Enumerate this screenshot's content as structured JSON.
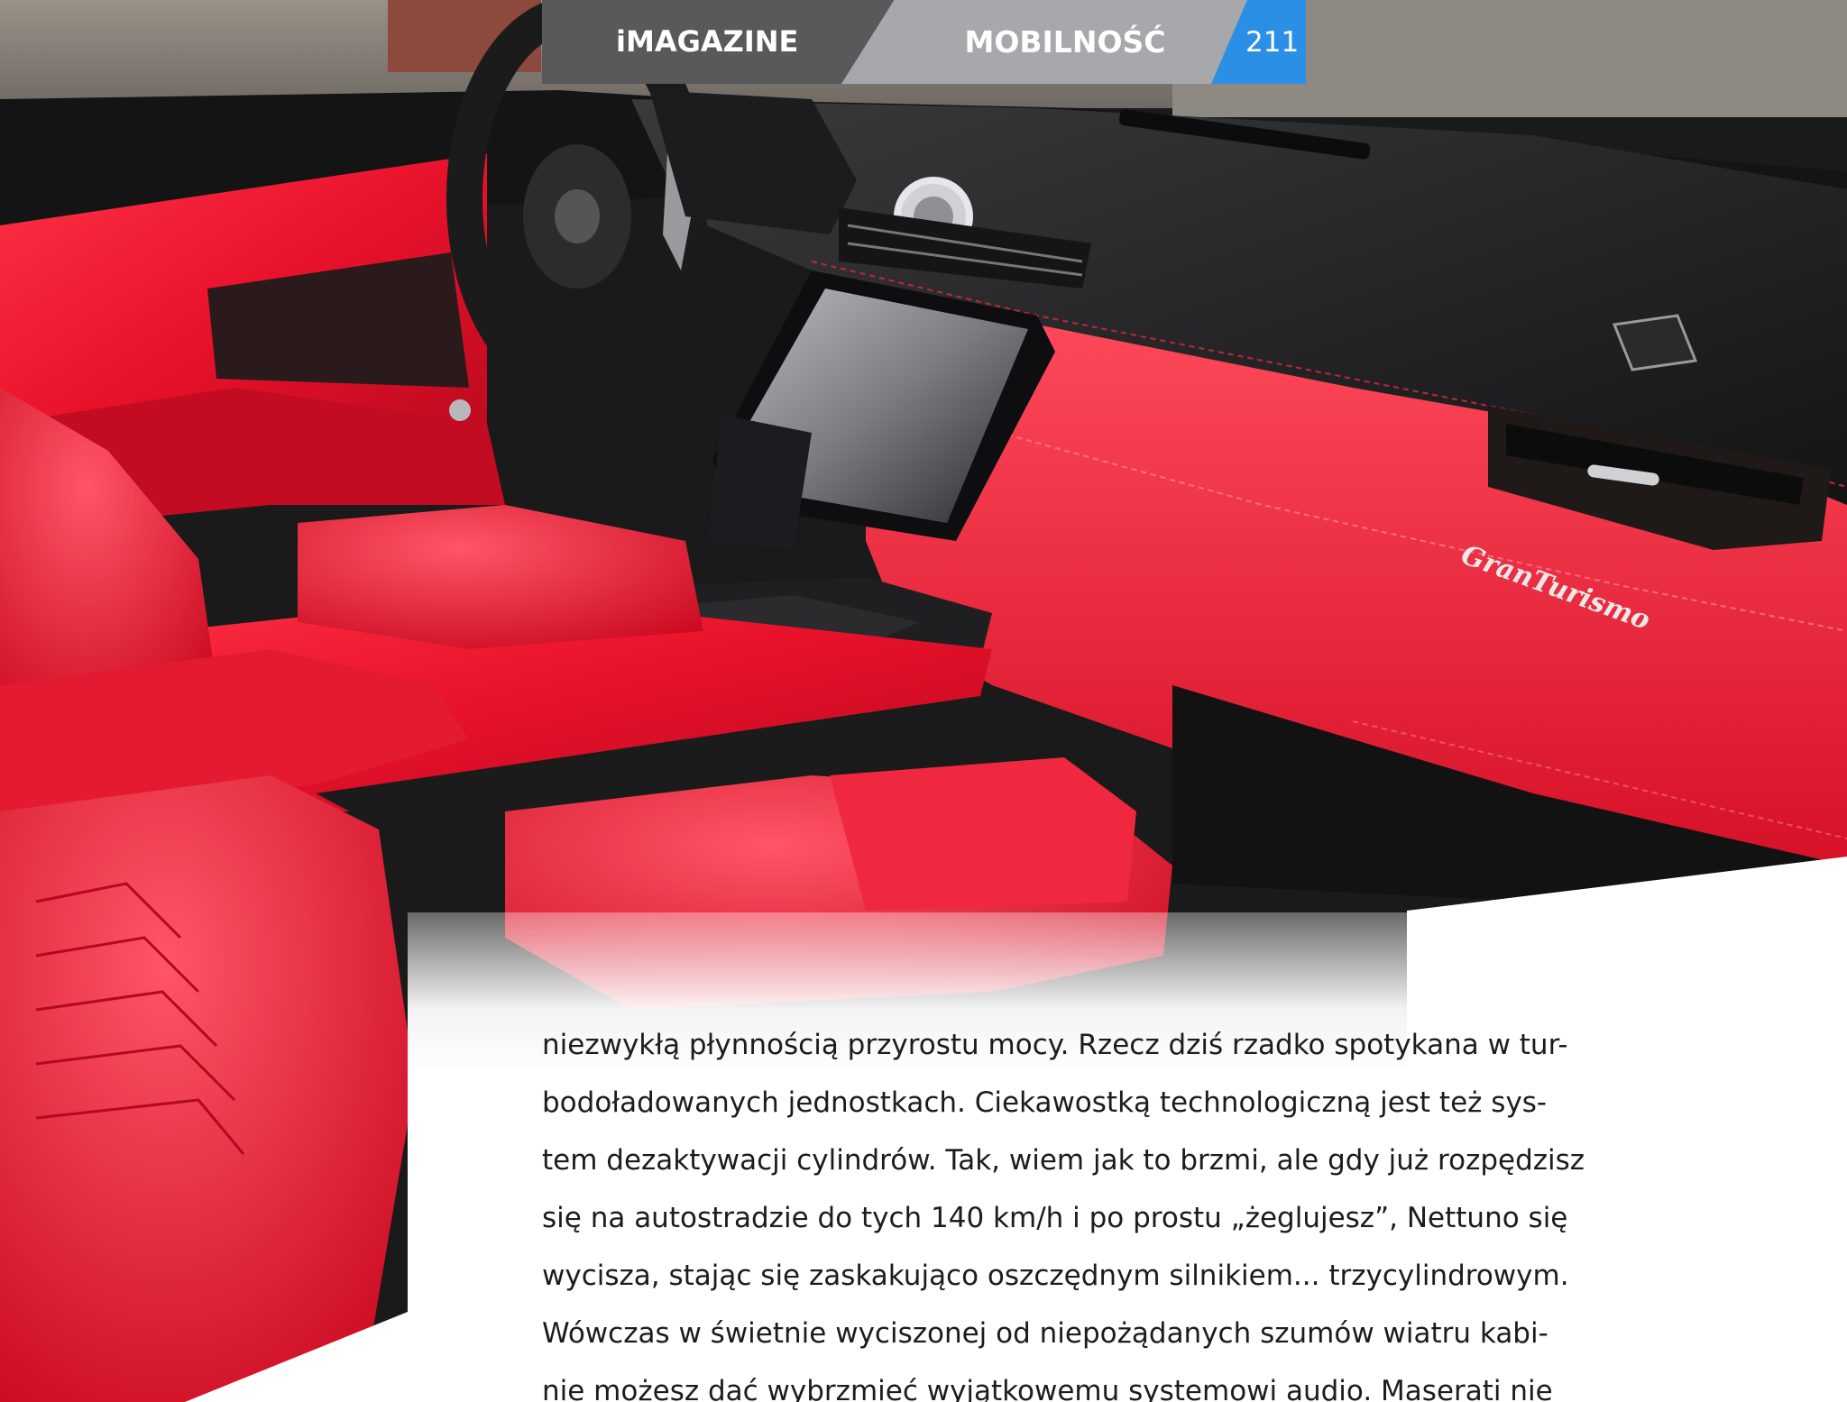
{
  "header": {
    "logo_text": "iMAGAZINE",
    "section": "MOBILNOŚĆ",
    "page_number": "211"
  },
  "photo": {
    "subject": "red-leather-car-interior",
    "badge_text": "GranTurismo"
  },
  "article": {
    "lines": [
      "niezwykłą płynnością przyrostu mocy. Rzecz dziś rzadko spotykana w tur-",
      "bodoładowanych jednostkach. Ciekawostką technologiczną jest też sys-",
      "tem dezaktywacji cylindrów. Tak, wiem jak to brzmi, ale gdy już rozpędzisz",
      "się na autostradzie do tych 140 km/h i po prostu „żeglujesz”, Nettuno się",
      "wycisza, stając się zaskakująco oszczędnym silnikiem... trzycylindrowym.",
      "Wówczas w świetnie wyciszonej od niepożądanych szumów wiatru kabi-",
      "nie możesz dać wybrzmieć wyjątkowemu systemowi audio. Maserati nie"
    ]
  },
  "colors": {
    "header_dark": "#58595b",
    "header_light": "#a6a8ab",
    "header_accent": "#2b8fe6",
    "leather_red": "#e8112a",
    "body_text": "#1c1c1c"
  }
}
